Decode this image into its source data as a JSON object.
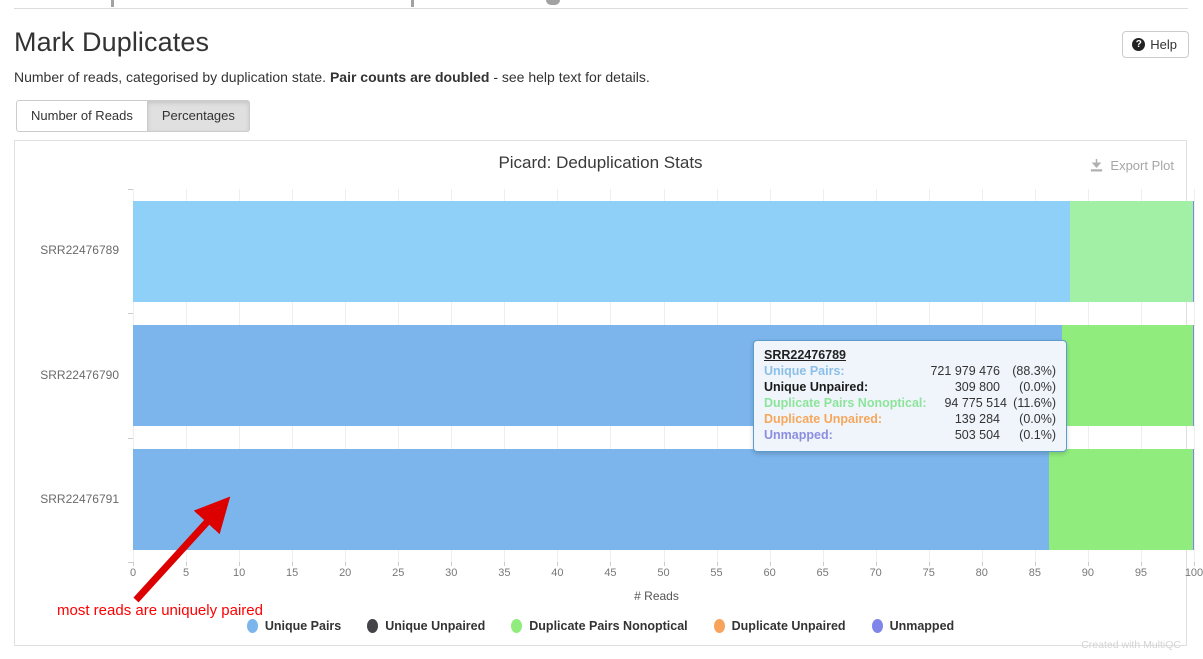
{
  "header": {
    "title": "Mark Duplicates",
    "subtitle_pre": "Number of reads, categorised by duplication state. ",
    "subtitle_bold": "Pair counts are doubled",
    "subtitle_post": " - see help text for details.",
    "help_label": "Help",
    "help_icon": "question-circle-icon"
  },
  "tabs": [
    {
      "label": "Number of Reads",
      "active": false
    },
    {
      "label": "Percentages",
      "active": true
    }
  ],
  "panel": {
    "chart_title": "Picard: Deduplication Stats",
    "export_label": "Export Plot",
    "export_icon": "download-icon"
  },
  "tooltip": {
    "sample": "SRR22476789",
    "rows": [
      {
        "label": "Unique Pairs:",
        "value": "721 979 476",
        "percent": "(88.3%)",
        "color": "#8bbfe8"
      },
      {
        "label": "Unique Unpaired:",
        "value": "309 800",
        "percent": "(0.0%)",
        "color": "#1a1a1a"
      },
      {
        "label": "Duplicate Pairs Nonoptical:",
        "value": "94 775 514",
        "percent": "(11.6%)",
        "color": "#8ce49b"
      },
      {
        "label": "Duplicate Unpaired:",
        "value": "139 284",
        "percent": "(0.0%)",
        "color": "#f5a75b"
      },
      {
        "label": "Unmapped:",
        "value": "503 504",
        "percent": "(0.1%)",
        "color": "#8b8ee0"
      }
    ]
  },
  "legend": [
    {
      "label": "Unique Pairs",
      "color": "#7cb5ec"
    },
    {
      "label": "Unique Unpaired",
      "color": "#434348"
    },
    {
      "label": "Duplicate Pairs Nonoptical",
      "color": "#90ed7d"
    },
    {
      "label": "Duplicate Unpaired",
      "color": "#f7a35c"
    },
    {
      "label": "Unmapped",
      "color": "#8085e9"
    }
  ],
  "annotation": {
    "text": "most reads are uniquely paired",
    "color": "#dd0000"
  },
  "footer": {
    "note": "Created with MultiQC"
  },
  "chart_data": {
    "type": "bar",
    "orientation": "horizontal",
    "stacked": true,
    "title": "Picard: Deduplication Stats",
    "xlabel": "# Reads",
    "ylabel": "",
    "xlim": [
      0,
      100
    ],
    "xticks": [
      0,
      5,
      10,
      15,
      20,
      25,
      30,
      35,
      40,
      45,
      50,
      55,
      60,
      65,
      70,
      75,
      80,
      85,
      90,
      95,
      100
    ],
    "grid": true,
    "legend_position": "bottom",
    "categories": [
      "SRR22476789",
      "SRR22476790",
      "SRR22476791"
    ],
    "series": [
      {
        "name": "Unique Pairs",
        "color": "#7cb5ec",
        "values": [
          88.3,
          87.6,
          86.3
        ]
      },
      {
        "name": "Unique Unpaired",
        "color": "#434348",
        "values": [
          0.0,
          0.0,
          0.0
        ]
      },
      {
        "name": "Duplicate Pairs Nonoptical",
        "color": "#90ed7d",
        "values": [
          11.6,
          12.3,
          13.6
        ]
      },
      {
        "name": "Duplicate Unpaired",
        "color": "#f7a35c",
        "values": [
          0.0,
          0.0,
          0.0
        ]
      },
      {
        "name": "Unmapped",
        "color": "#8085e9",
        "values": [
          0.1,
          0.1,
          0.1
        ]
      }
    ],
    "hovered_category": "SRR22476789"
  }
}
